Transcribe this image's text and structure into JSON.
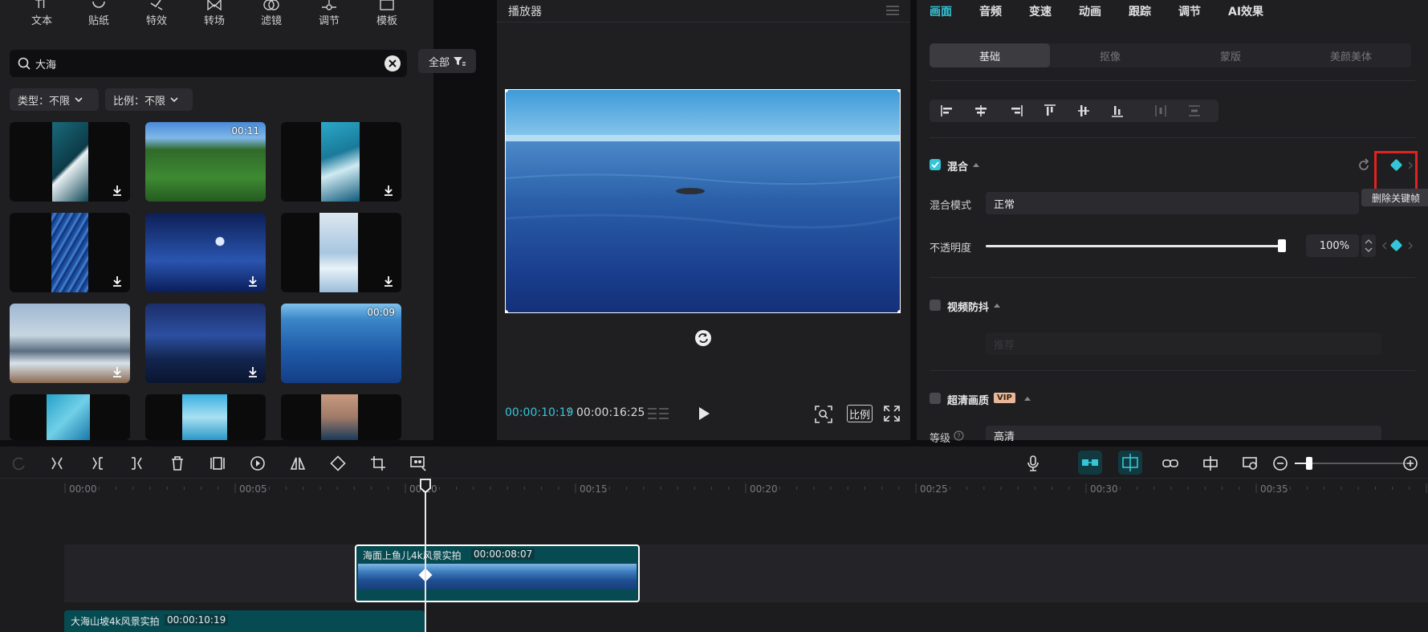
{
  "left_panel": {
    "tabs": [
      "文本",
      "贴纸",
      "特效",
      "转场",
      "滤镜",
      "调节",
      "模板"
    ],
    "search": {
      "value": "大海"
    },
    "filter_label": "全部",
    "filters": [
      {
        "label": "类型：不限"
      },
      {
        "label": "比例：不限"
      }
    ],
    "thumbnails": [
      {
        "duration": ""
      },
      {
        "duration": "00:11"
      },
      {
        "duration": ""
      },
      {
        "duration": ""
      },
      {
        "duration": ""
      },
      {
        "duration": ""
      },
      {
        "duration": ""
      },
      {
        "duration": ""
      },
      {
        "duration": "00:09"
      },
      {
        "duration": ""
      },
      {
        "duration": ""
      },
      {
        "duration": ""
      }
    ]
  },
  "player": {
    "title": "播放器",
    "time_current": "00:00:10:19",
    "time_separator": "/",
    "time_total": "00:00:16:25",
    "ratio_label": "比例"
  },
  "right_panel": {
    "tabs": [
      "画面",
      "音频",
      "变速",
      "动画",
      "跟踪",
      "调节",
      "AI效果"
    ],
    "subtabs": [
      "基础",
      "抠像",
      "蒙版",
      "美颜美体"
    ],
    "blend": {
      "title": "混合",
      "mode_label": "混合模式",
      "mode_value": "正常",
      "opacity_label": "不透明度",
      "opacity_value": "100%",
      "tooltip": "删除关键帧"
    },
    "stabilize": {
      "title": "视频防抖",
      "value": "推荐"
    },
    "hd": {
      "title": "超清画质",
      "vip": "VIP",
      "level_label": "等级",
      "level_value": "高清"
    }
  },
  "timeline": {
    "ruler_labels": [
      "00:00",
      "00:05",
      "00:10",
      "00:15",
      "00:20",
      "00:25",
      "00:30",
      "00:35"
    ],
    "clips": [
      {
        "label": "海面上鱼儿4k风景实拍",
        "duration": "00:00:08:07"
      },
      {
        "label": "大海山坡4k风景实拍",
        "duration": "00:00:10:19"
      }
    ]
  },
  "colors": {
    "accent": "#34c6d8",
    "highlight": "#e0231f",
    "panel": "#1f1f22"
  }
}
